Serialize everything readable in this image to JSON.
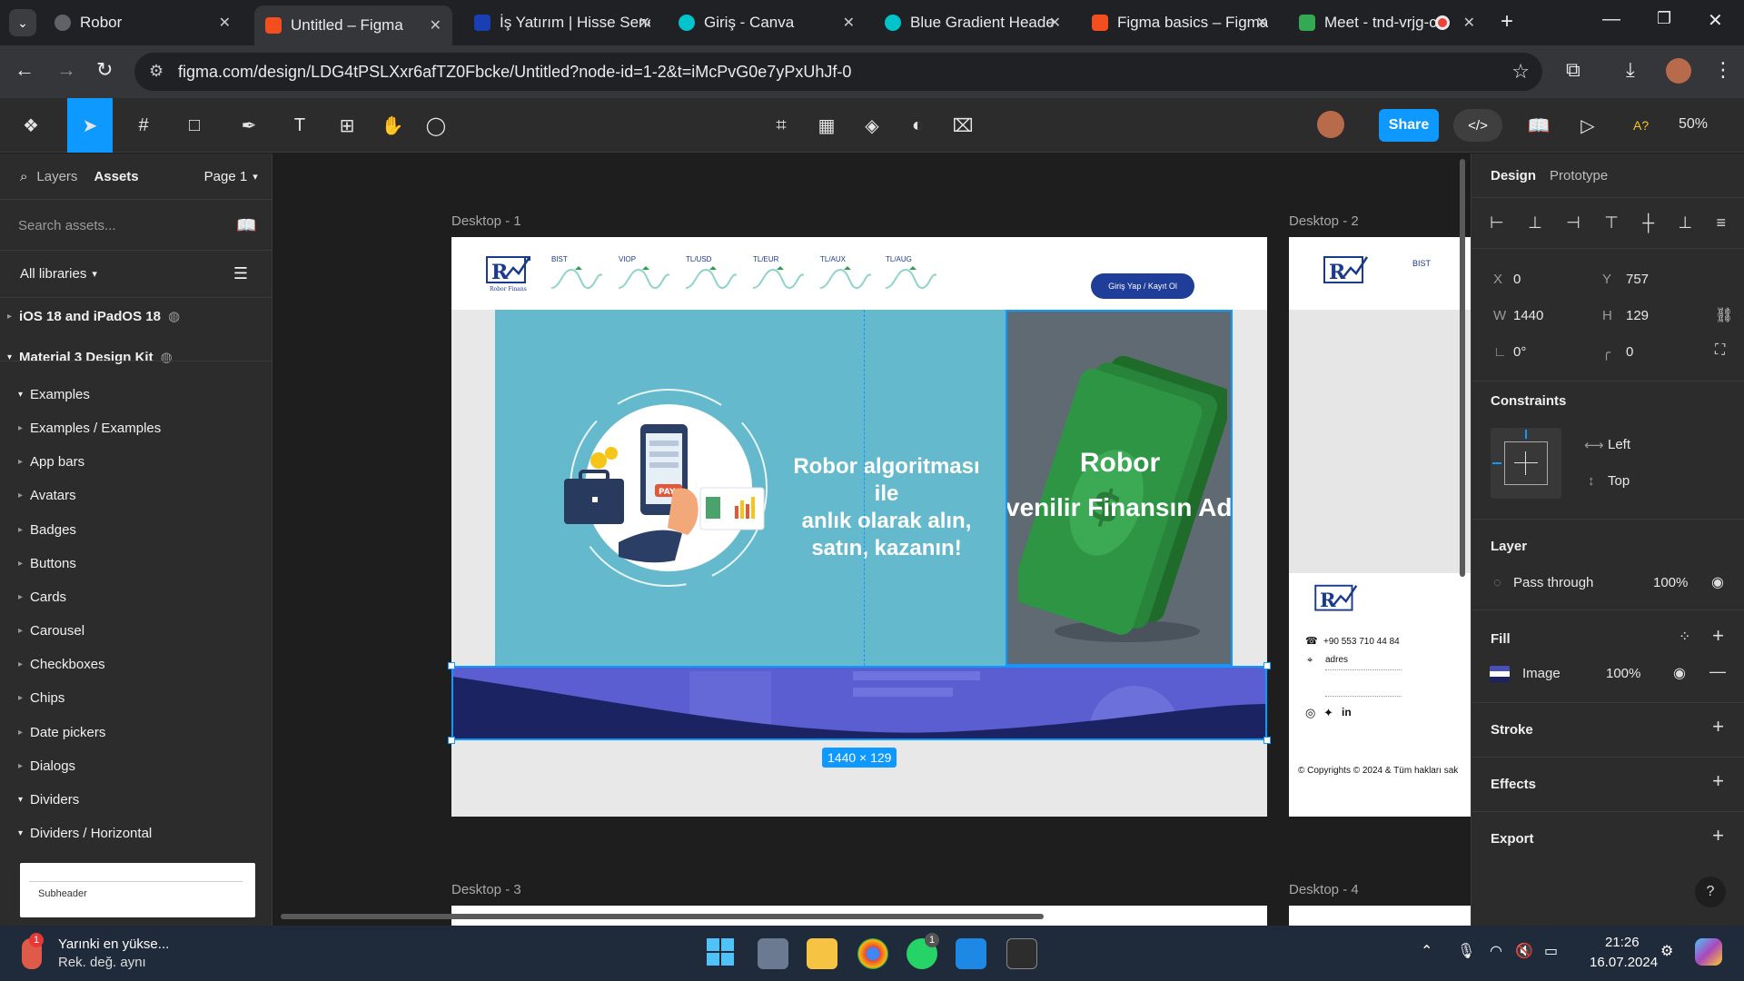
{
  "browser": {
    "tabs": [
      {
        "title": "Robor",
        "color": "#5f6368"
      },
      {
        "title": "Untitled – Figma",
        "color": "#f24e1e"
      },
      {
        "title": "İş Yatırım | Hisse Sene",
        "color": "#1a3fb5"
      },
      {
        "title": "Giriş - Canva",
        "color": "#00c4cc"
      },
      {
        "title": "Blue Gradient Heade",
        "color": "#00c4cc"
      },
      {
        "title": "Figma basics – Figma",
        "color": "#f24e1e"
      },
      {
        "title": "Meet - tnd-vrjg-c",
        "color": "#34a853"
      }
    ],
    "url": "figma.com/design/LDG4tPSLXxr6afTZ0Fbcke/Untitled?node-id=1-2&t=iMcPvG0e7yPxUhJf-0"
  },
  "toolbar": {
    "share_label": "Share",
    "zoom": "50%",
    "ai_label": "A?"
  },
  "left_panel": {
    "tab_layers": "Layers",
    "tab_assets": "Assets",
    "page": "Page 1",
    "search_placeholder": "Search assets...",
    "libraries": "All libraries",
    "items": [
      {
        "label": "iOS 18 and iPadOS 18",
        "level": 0,
        "expanded": false
      },
      {
        "label": "Material 3 Design Kit",
        "level": 0,
        "expanded": true
      },
      {
        "label": "Examples",
        "level": 1,
        "expanded": true
      },
      {
        "label": "Examples / Examples",
        "level": 1,
        "expanded": false
      },
      {
        "label": "App bars",
        "level": 1,
        "expanded": false
      },
      {
        "label": "Avatars",
        "level": 1,
        "expanded": false
      },
      {
        "label": "Badges",
        "level": 1,
        "expanded": false
      },
      {
        "label": "Buttons",
        "level": 1,
        "expanded": false
      },
      {
        "label": "Cards",
        "level": 1,
        "expanded": false
      },
      {
        "label": "Carousel",
        "level": 1,
        "expanded": false
      },
      {
        "label": "Checkboxes",
        "level": 1,
        "expanded": false
      },
      {
        "label": "Chips",
        "level": 1,
        "expanded": false
      },
      {
        "label": "Date pickers",
        "level": 1,
        "expanded": false
      },
      {
        "label": "Dialogs",
        "level": 1,
        "expanded": false
      },
      {
        "label": "Dividers",
        "level": 1,
        "expanded": true
      },
      {
        "label": "Dividers / Horizontal",
        "level": 1,
        "expanded": true
      }
    ],
    "preview_label": "Subheader"
  },
  "canvas": {
    "frames": [
      "Desktop - 1",
      "Desktop - 2",
      "Desktop - 3",
      "Desktop - 4"
    ],
    "logo_text": "Robor Finans",
    "tickers": [
      "BIST",
      "VIOP",
      "TL/USD",
      "TL/EUR",
      "TL/AUX",
      "TL/AUG"
    ],
    "login_button": "Giriş Yap / Kayıt Ol",
    "hero_text": "Robor algoritması ile anlık olarak alın, satın, kazanın!",
    "hero_line1": "Robor algoritması ile",
    "hero_line2": "anlık olarak alın,",
    "hero_line3": "satın, kazanın!",
    "pay_label": "PAY",
    "right_title": "Robor",
    "right_subtitle": "venilir Finansın Adı",
    "selection_size": "1440 × 129",
    "footer_phone": "+90 553 710 44 84",
    "footer_address": "adres",
    "footer_copyright": "© Copyrights © 2024 & Tüm hakları sak"
  },
  "right_panel": {
    "tab_design": "Design",
    "tab_prototype": "Prototype",
    "x": "0",
    "y": "757",
    "w": "1440",
    "h": "129",
    "rotation": "0°",
    "radius": "0",
    "constraints_title": "Constraints",
    "constraint_h": "Left",
    "constraint_v": "Top",
    "layer_title": "Layer",
    "blend": "Pass through",
    "opacity": "100%",
    "fill_title": "Fill",
    "fill_type": "Image",
    "fill_opacity": "100%",
    "stroke_title": "Stroke",
    "effects_title": "Effects",
    "export_title": "Export"
  },
  "taskbar": {
    "weather_line1": "Yarınki en yükse...",
    "weather_line2": "Rek. değ. aynı",
    "weather_badge": "1",
    "whatsapp_badge": "1",
    "time": "21:26",
    "date": "16.07.2024"
  }
}
